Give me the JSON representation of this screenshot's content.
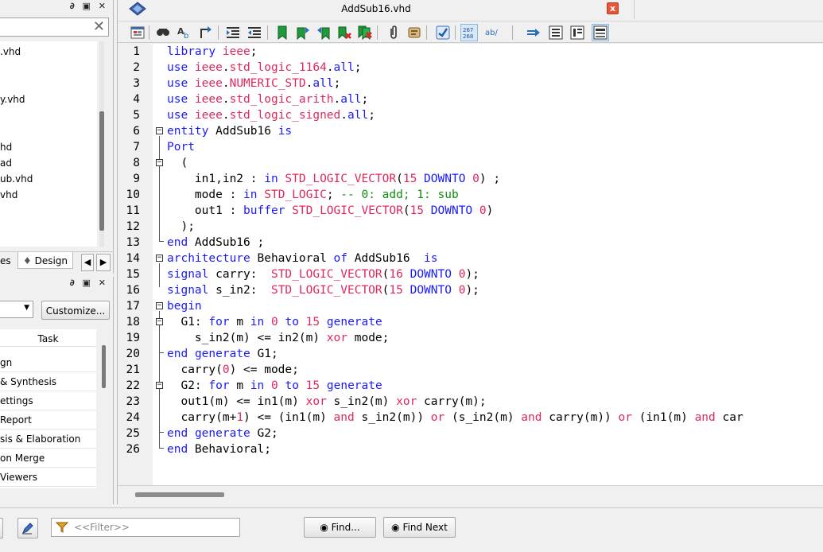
{
  "editor": {
    "title": "AddSub16.vhd",
    "close_symbol": "x"
  },
  "left_top": {
    "pane_buttons": "∂ ▣ ✕",
    "search_clear": "✕",
    "files": [
      ".vhd",
      "y.vhd",
      "hd",
      "ad",
      "ub.vhd",
      "vhd"
    ],
    "tab_left": "es",
    "tab_design": "Design"
  },
  "left_bottom": {
    "pane_buttons": "∂ ▣ ✕",
    "customize_label": "Customize...",
    "task_header": "Task",
    "tasks": [
      "gn",
      "& Synthesis",
      "ettings",
      "Report",
      "sis & Elaboration",
      "on Merge",
      " Viewers"
    ]
  },
  "bottom": {
    "filter_placeholder": "<<Filter>>",
    "find_label": "Find...",
    "find_next_label": "Find Next"
  },
  "code_lines": [
    {
      "n": "1"
    },
    {
      "n": "2"
    },
    {
      "n": "3"
    },
    {
      "n": "4"
    },
    {
      "n": "5"
    },
    {
      "n": "6"
    },
    {
      "n": "7"
    },
    {
      "n": "8"
    },
    {
      "n": "9"
    },
    {
      "n": "10"
    },
    {
      "n": "11"
    },
    {
      "n": "12"
    },
    {
      "n": "13"
    },
    {
      "n": "14"
    },
    {
      "n": "15"
    },
    {
      "n": "16"
    },
    {
      "n": "17"
    },
    {
      "n": "18"
    },
    {
      "n": "19"
    },
    {
      "n": "20"
    },
    {
      "n": "21"
    },
    {
      "n": "22"
    },
    {
      "n": "23"
    },
    {
      "n": "24"
    },
    {
      "n": "25"
    },
    {
      "n": "26"
    }
  ],
  "code": {
    "l1": [
      "library",
      " ",
      "ieee",
      ";"
    ],
    "l2": [
      "use",
      " ",
      "ieee",
      ".",
      "std_logic_1164",
      ".",
      "all",
      ";"
    ],
    "l3": [
      "use",
      " ",
      "ieee",
      ".",
      "NUMERIC_STD",
      ".",
      "all",
      ";"
    ],
    "l4": [
      "use",
      " ",
      "ieee",
      ".",
      "std_logic_arith",
      ".",
      "all",
      ";"
    ],
    "l5": [
      "use",
      " ",
      "ieee",
      ".",
      "std_logic_signed",
      ".",
      "all",
      ";"
    ],
    "l6": [
      "entity",
      " AddSub16 ",
      "is"
    ],
    "l7": [
      "Port"
    ],
    "l8": [
      "  ("
    ],
    "l9": [
      "    in1,in2 : ",
      "in",
      " ",
      "STD_LOGIC_VECTOR",
      "(",
      "15",
      " ",
      "DOWNTO",
      " ",
      "0",
      ") ;"
    ],
    "l10": [
      "    mode : ",
      "in",
      " ",
      "STD_LOGIC",
      "; ",
      "-- 0: add; 1: sub"
    ],
    "l11": [
      "    out1 : ",
      "buffer",
      " ",
      "STD_LOGIC_VECTOR",
      "(",
      "15",
      " ",
      "DOWNTO",
      " ",
      "0",
      ")"
    ],
    "l12": [
      "  );"
    ],
    "l13": [
      "end",
      " AddSub16 ;"
    ],
    "l14": [
      "architecture",
      " Behavioral ",
      "of",
      " AddSub16  ",
      "is"
    ],
    "l15": [
      "signal",
      " carry:  ",
      "STD_LOGIC_VECTOR",
      "(",
      "16",
      " ",
      "DOWNTO",
      " ",
      "0",
      ");"
    ],
    "l16": [
      "signal",
      " s_in2:  ",
      "STD_LOGIC_VECTOR",
      "(",
      "15",
      " ",
      "DOWNTO",
      " ",
      "0",
      ");"
    ],
    "l17": [
      "begin"
    ],
    "l18": [
      "  G1: ",
      "for",
      " m ",
      "in",
      " ",
      "0",
      " ",
      "to",
      " ",
      "15",
      " ",
      "generate"
    ],
    "l19": [
      "    s_in2(m) <= in2(m) ",
      "xor",
      " mode;"
    ],
    "l20": [
      "end",
      " ",
      "generate",
      " G1;"
    ],
    "l21": [
      "  carry(",
      "0",
      ") <= mode;"
    ],
    "l22": [
      "  G2: ",
      "for",
      " m ",
      "in",
      " ",
      "0",
      " ",
      "to",
      " ",
      "15",
      " ",
      "generate"
    ],
    "l23": [
      "  out1(m) <= in1(m) ",
      "xor",
      " s_in2(m) ",
      "xor",
      " carry(m);"
    ],
    "l24": [
      "  carry(m+",
      "1",
      ") <= (in1(m) ",
      "and",
      " s_in2(m)) ",
      "or",
      " (s_in2(m) ",
      "and",
      " carry(m)) ",
      "or",
      " (in1(m) ",
      "and",
      " car"
    ],
    "l25": [
      "end",
      " ",
      "generate",
      " G2;"
    ],
    "l26": [
      "end",
      " Behavioral;"
    ]
  },
  "colors": {
    "keyword": "#1a1aff",
    "type": "#e0285a",
    "number": "#e0285a",
    "comment": "#118e11"
  }
}
